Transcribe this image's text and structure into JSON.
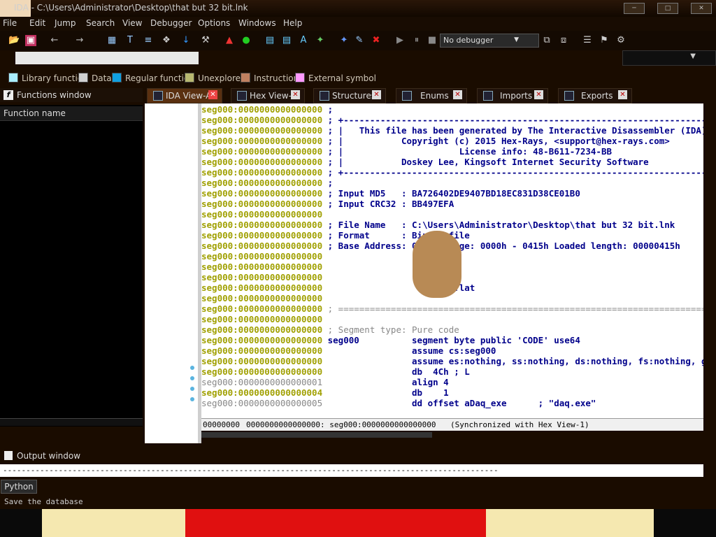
{
  "window": {
    "title": "IDA - C:\\Users\\Administrator\\Desktop\\that but 32 bit.lnk",
    "controls": [
      "minimize",
      "maximize",
      "close"
    ]
  },
  "menu": [
    "File",
    "Edit",
    "Jump",
    "Search",
    "View",
    "Debugger",
    "Options",
    "Windows",
    "Help"
  ],
  "toolbar": {
    "debugger_select": "No debugger"
  },
  "legend": [
    {
      "label": "Library function",
      "color": "#aaeeff"
    },
    {
      "label": "Data",
      "color": "#d0d0d0"
    },
    {
      "label": "Regular function",
      "color": "#10a0e0"
    },
    {
      "label": "Unexplored",
      "color": "#b8b870"
    },
    {
      "label": "Instruction",
      "color": "#c08060"
    },
    {
      "label": "External symbol",
      "color": "#ff99ff"
    }
  ],
  "functions_window": {
    "title": "Functions window",
    "column": "Function name"
  },
  "tabs": [
    {
      "label": "IDA View-A",
      "active": true
    },
    {
      "label": "Hex View-1",
      "active": false
    },
    {
      "label": "Structures",
      "active": false
    },
    {
      "label": "Enums",
      "active": false
    },
    {
      "label": "Imports",
      "active": false
    },
    {
      "label": "Exports",
      "active": false
    }
  ],
  "disasm": [
    {
      "addr": "seg000:0000000000000000",
      "text": " ;"
    },
    {
      "addr": "seg000:0000000000000000",
      "text": " ; +-------------------------------------------------------------------------+"
    },
    {
      "addr": "seg000:0000000000000000",
      "text": " ; |   This file has been generated by The Interactive Disassembler (IDA)   |"
    },
    {
      "addr": "seg000:0000000000000000",
      "text": " ; |           Copyright (c) 2015 Hex-Rays, <support@hex-rays.com>           |"
    },
    {
      "addr": "seg000:0000000000000000",
      "text": " ; |                      License info: 48-B611-7234-BB                      |"
    },
    {
      "addr": "seg000:0000000000000000",
      "text": " ; |           Doskey Lee, Kingsoft Internet Security Software            |"
    },
    {
      "addr": "seg000:0000000000000000",
      "text": " ; +-------------------------------------------------------------------------+"
    },
    {
      "addr": "seg000:0000000000000000",
      "text": " ;"
    },
    {
      "addr": "seg000:0000000000000000",
      "text": " ; Input MD5   : BA726402DE9407BD18EC831D38CE01B0"
    },
    {
      "addr": "seg000:0000000000000000",
      "text": " ; Input CRC32 : BB497EFA"
    },
    {
      "addr": "seg000:0000000000000000",
      "text": ""
    },
    {
      "addr": "seg000:0000000000000000",
      "text": " ; File Name   : C:\\Users\\Administrator\\Desktop\\that but 32 bit.lnk"
    },
    {
      "addr": "seg000:0000000000000000",
      "text": " ; Format      : Binary file"
    },
    {
      "addr": "seg000:0000000000000000",
      "text": " ; Base Address: 0000h Range: 0000h - 0415h Loaded length: 00000415h"
    },
    {
      "addr": "seg000:0000000000000000",
      "text": ""
    },
    {
      "addr": "seg000:0000000000000000",
      "text": ""
    },
    {
      "addr": "seg000:0000000000000000",
      "text": ""
    },
    {
      "addr": "seg000:0000000000000000",
      "text": "                  .model flat"
    },
    {
      "addr": "seg000:0000000000000000",
      "text": ""
    },
    {
      "addr": "seg000:0000000000000000",
      "text": " ; ===========================================================================",
      "gray": true
    },
    {
      "addr": "seg000:0000000000000000",
      "text": ""
    },
    {
      "addr": "seg000:0000000000000000",
      "text": " ; Segment type: Pure code",
      "gray": true
    },
    {
      "addr": "seg000:0000000000000000",
      "text": " seg000          segment byte public 'CODE' use64",
      "code": true
    },
    {
      "addr": "seg000:0000000000000000",
      "text": "                 assume cs:seg000",
      "code": true
    },
    {
      "addr": "seg000:0000000000000000",
      "text": "                 assume es:nothing, ss:nothing, ds:nothing, fs:nothing, gs:nothing",
      "code": true
    },
    {
      "addr": "seg000:0000000000000000",
      "text": "                 db  4Ch ; L",
      "code": true
    },
    {
      "addr": "seg000:0000000000000001",
      "text": "                 align 4",
      "code": true,
      "gray_addr": true
    },
    {
      "addr": "seg000:0000000000000004",
      "text": "                 db    1",
      "code": true
    },
    {
      "addr": "seg000:0000000000000005",
      "text": "                 dd offset aDaq_exe      ; \"daq.exe\"",
      "code": true,
      "gray_addr": true
    }
  ],
  "status": {
    "offset": "00000000",
    "location": "0000000000000000: seg000:0000000000000000",
    "sync": "(Synchronized with Hex View-1)"
  },
  "output_window": {
    "title": "Output window",
    "content": "-----------------------------------------------------------------------------------------------------------"
  },
  "python_button": "Python",
  "status_line": "Save the database"
}
